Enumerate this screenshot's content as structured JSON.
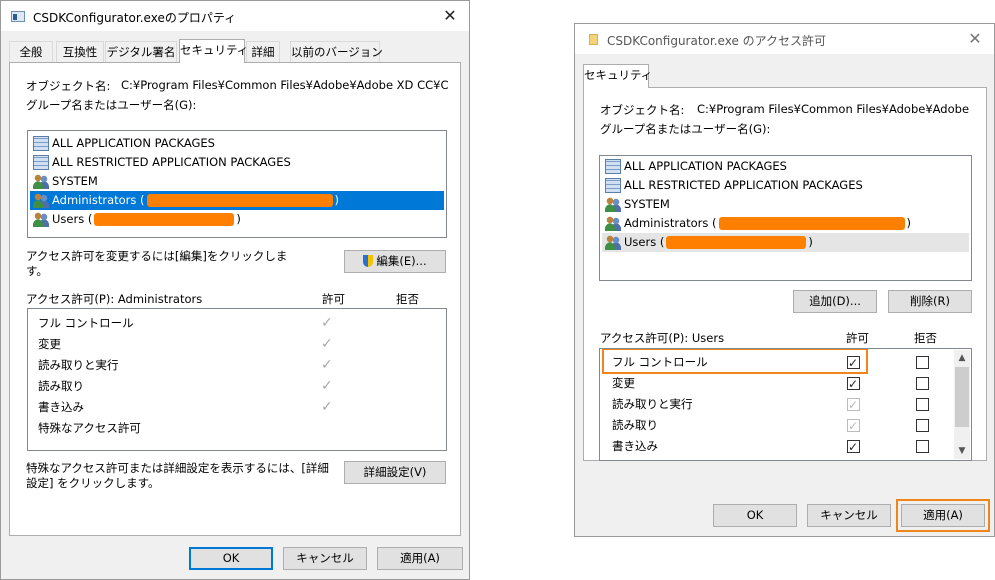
{
  "left": {
    "title": "CSDKConfigurator.exeのプロパティ",
    "tabs": [
      "全般",
      "互換性",
      "デジタル署名",
      "セキュリティ",
      "詳細",
      "以前のバージョン"
    ],
    "object_label": "オブジェクト名:",
    "object_value": "C:¥Program Files¥Common Files¥Adobe¥Adobe XD CC¥CSDKCo",
    "group_label": "グループ名またはユーザー名(G):",
    "groups": [
      {
        "name": "ALL APPLICATION PACKAGES",
        "icon": "packages-icon"
      },
      {
        "name": "ALL RESTRICTED APPLICATION PACKAGES",
        "icon": "packages-icon"
      },
      {
        "name": "SYSTEM",
        "icon": "users-icon"
      },
      {
        "name": "Administrators (",
        "suffix": ")",
        "icon": "users-icon",
        "selected": true
      },
      {
        "name": "Users (",
        "suffix": ")",
        "icon": "users-icon"
      }
    ],
    "change_note": "アクセス許可を変更するには[編集]をクリックしま\nす。",
    "edit_button": "編集(E)...",
    "perm_label": "アクセス許可(P): Administrators",
    "allow_header": "許可",
    "deny_header": "拒否",
    "permissions": [
      "フル コントロール",
      "変更",
      "読み取りと実行",
      "読み取り",
      "書き込み",
      "特殊なアクセス許可"
    ],
    "advanced_note": "特殊なアクセス許可または詳細設定を表示するには、[詳細\n設定] をクリックします。",
    "advanced_button": "詳細設定(V)",
    "ok": "OK",
    "cancel": "キャンセル",
    "apply": "適用(A)"
  },
  "right": {
    "title": "CSDKConfigurator.exe のアクセス許可",
    "tab": "セキュリティ",
    "object_label": "オブジェクト名:",
    "object_value": "C:¥Program Files¥Common Files¥Adobe¥Adobe XD CC",
    "group_label": "グループ名またはユーザー名(G):",
    "groups": [
      {
        "name": "ALL APPLICATION PACKAGES",
        "icon": "packages-icon"
      },
      {
        "name": "ALL RESTRICTED APPLICATION PACKAGES",
        "icon": "packages-icon"
      },
      {
        "name": "SYSTEM",
        "icon": "users-icon"
      },
      {
        "name": "Administrators (",
        "suffix": ")",
        "icon": "users-icon"
      },
      {
        "name": "Users (",
        "suffix": ")",
        "icon": "users-icon",
        "selected": true
      }
    ],
    "add_button": "追加(D)...",
    "remove_button": "削除(R)",
    "perm_label": "アクセス許可(P): Users",
    "allow_header": "許可",
    "deny_header": "拒否",
    "permissions": [
      {
        "name": "フル コントロール",
        "allow": true,
        "allow_enabled": true,
        "deny": false
      },
      {
        "name": "変更",
        "allow": true,
        "allow_enabled": true,
        "deny": false
      },
      {
        "name": "読み取りと実行",
        "allow": true,
        "allow_enabled": false,
        "deny": false
      },
      {
        "name": "読み取り",
        "allow": true,
        "allow_enabled": false,
        "deny": false
      },
      {
        "name": "書き込み",
        "allow": true,
        "allow_enabled": true,
        "deny": false
      }
    ],
    "ok": "OK",
    "cancel": "キャンセル",
    "apply": "適用(A)"
  },
  "colors": {
    "selection": "#0078d7",
    "redaction": "#ff8000",
    "highlight_box": "#f08519"
  }
}
